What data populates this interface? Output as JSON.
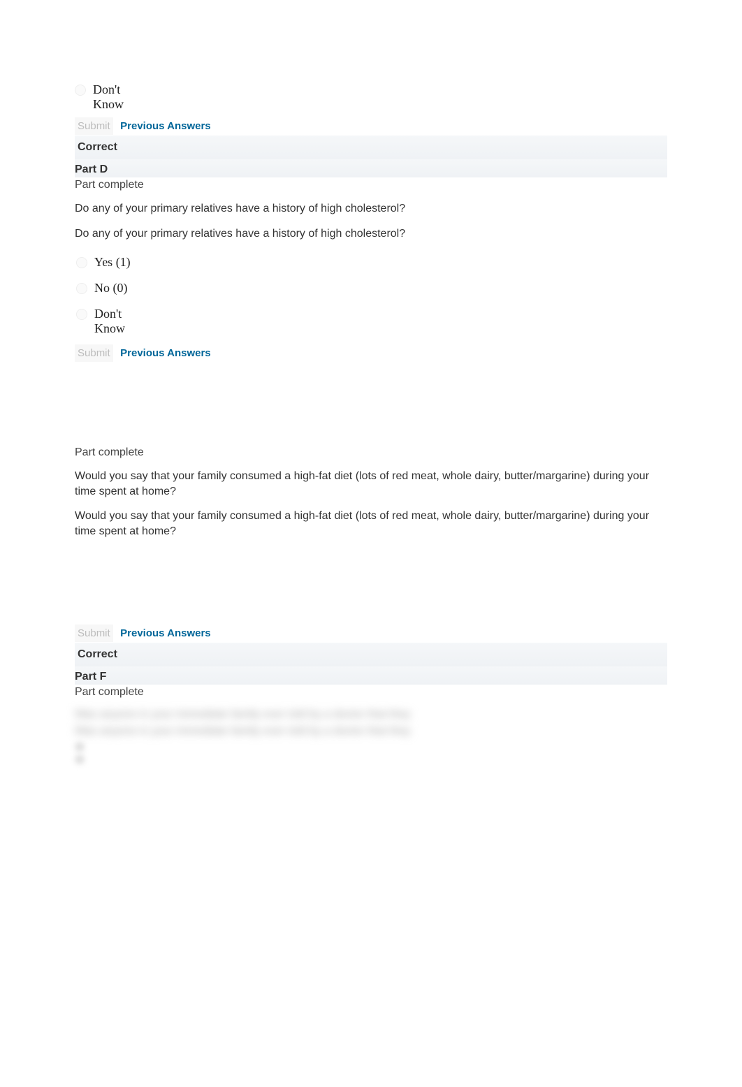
{
  "topOption": {
    "label": "Don't Know"
  },
  "buttons": {
    "submit": "Submit",
    "previous": "Previous Answers"
  },
  "correctLabel": "Correct",
  "partD": {
    "header": "Part D",
    "status": "Part complete",
    "question1": "Do any of your primary relatives have a history of high cholesterol?",
    "question2": "Do any of your primary relatives have a history of high cholesterol?",
    "options": {
      "yes": "Yes (1)",
      "no": "No (0)",
      "dk": "Don't Know"
    }
  },
  "partE": {
    "status": "Part complete",
    "question1": "Would you say that your family consumed a high-fat diet (lots of red meat, whole dairy, butter/margarine) during your time spent at home?",
    "question2": "Would you say that your family consumed a high-fat diet (lots of red meat, whole dairy, butter/margarine) during your time spent at home?"
  },
  "partF": {
    "header": "Part F",
    "status": "Part complete",
    "blurred1": "Was anyone in your immediate family ever told by a doctor that they",
    "blurred2": "Was anyone in your immediate family ever told by a doctor that they"
  }
}
